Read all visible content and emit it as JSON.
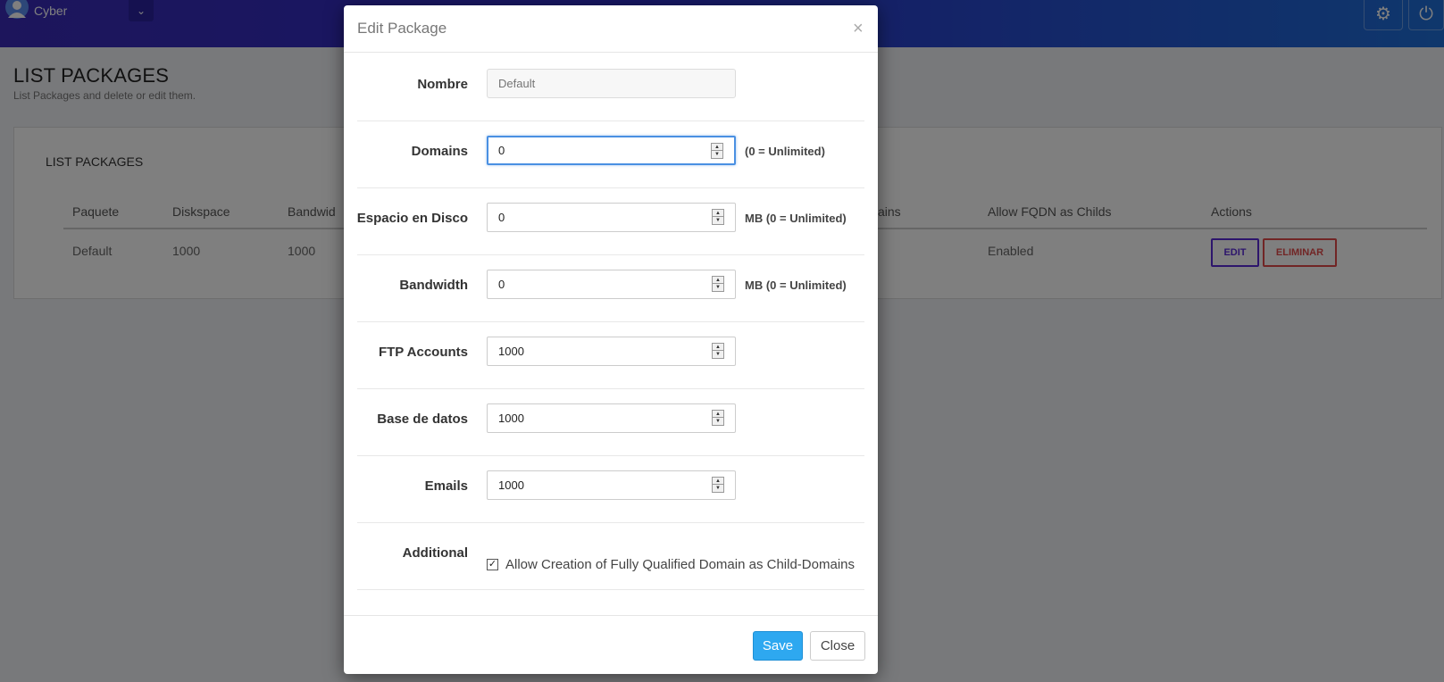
{
  "topbar": {
    "user_name": "Cyber"
  },
  "page": {
    "title": "LIST PACKAGES",
    "subtitle": "List Packages and delete or edit them."
  },
  "panel": {
    "title": "LIST PACKAGES",
    "columns": [
      "Paquete",
      "Diskspace",
      "Bandwid",
      "ains",
      "Allow FQDN as Childs",
      "Actions"
    ],
    "rows": [
      {
        "package": "Default",
        "diskspace": "1000",
        "bandwidth": "1000",
        "fqdn": "Enabled",
        "edit_label": "EDIT",
        "delete_label": "ELIMINAR"
      }
    ]
  },
  "modal": {
    "title": "Edit Package",
    "close_glyph": "×",
    "fields": {
      "nombre": {
        "label": "Nombre",
        "placeholder": "Default"
      },
      "domains": {
        "label": "Domains",
        "value": "0",
        "hint": "(0 = Unlimited)"
      },
      "disk": {
        "label": "Espacio en Disco",
        "value": "0",
        "hint": "MB (0 = Unlimited)"
      },
      "bandwidth": {
        "label": "Bandwidth",
        "value": "0",
        "hint": "MB (0 = Unlimited)"
      },
      "ftp": {
        "label": "FTP Accounts",
        "value": "1000"
      },
      "db": {
        "label": "Base de datos",
        "value": "1000"
      },
      "emails": {
        "label": "Emails",
        "value": "1000"
      },
      "additional": {
        "label": "Additional",
        "checkbox_label": "Allow Creation of Fully Qualified Domain as Child-Domains",
        "checked": true
      }
    },
    "save_label": "Save",
    "close_label": "Close"
  },
  "colors": {
    "accent": "#2ea8f0",
    "edit": "#5a2bd8",
    "delete": "#e34b4b"
  }
}
